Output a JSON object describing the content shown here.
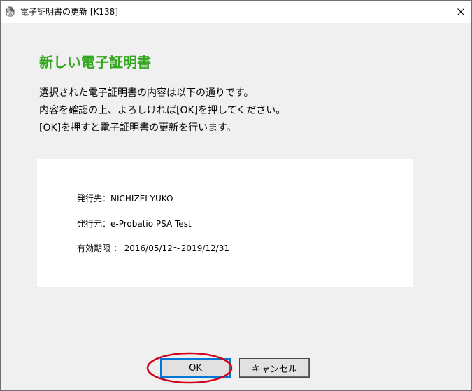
{
  "window": {
    "title": "電子証明書の更新 [K138]",
    "close_symbol": "✕"
  },
  "heading": "新しい電子証明書",
  "message_lines": [
    "選択された電子証明書の内容は以下の通りです。",
    "内容を確認の上、よろしければ[OK]を押してください。",
    "[OK]を押すと電子証明書の更新を行います。"
  ],
  "certificate": {
    "issued_to": "発行先：NICHIZEI YUKO",
    "issued_by": "発行元：e-Probatio PSA Test",
    "validity": "有効期限 ： 2016/05/12〜2019/12/31"
  },
  "buttons": {
    "ok_label": "OK",
    "cancel_label": "キャンセル"
  },
  "colors": {
    "heading": "#33a61f",
    "highlight": "#d0021b",
    "focus": "#0078d7"
  },
  "icons": {
    "app": "certificate-app-icon",
    "close": "close-icon"
  }
}
